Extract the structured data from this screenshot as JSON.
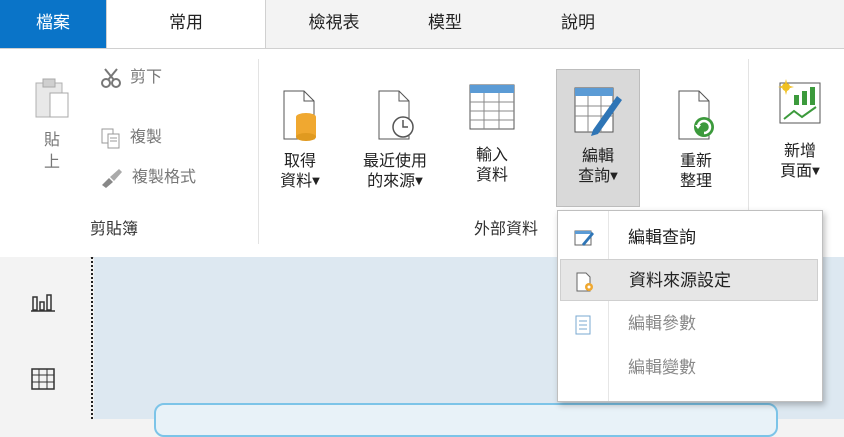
{
  "tabs": {
    "file": "檔案",
    "home": "常用",
    "view": "檢視表",
    "modeling": "模型",
    "help": "說明"
  },
  "clipboard": {
    "paste": "貼\n上",
    "paste_l1": "貼",
    "paste_l2": "上",
    "cut": "剪下",
    "copy": "複製",
    "format_painter": "複製格式",
    "group_label": "剪貼簿"
  },
  "external_data": {
    "get_data_l1": "取得",
    "get_data_l2": "資料",
    "recent_l1": "最近使用",
    "recent_l2": "的來源",
    "enter_l1": "輸入",
    "enter_l2": "資料",
    "edit_queries_l1": "編輯",
    "edit_queries_l2": "查詢",
    "refresh_l1": "重新",
    "refresh_l2": "整理",
    "group_label": "外部資料"
  },
  "insert": {
    "new_page_l1": "新增",
    "new_page_l2": "頁面"
  },
  "dropdown": {
    "items": [
      {
        "label": "編輯查詢",
        "enabled": true
      },
      {
        "label": "資料來源設定",
        "enabled": true,
        "highlighted": true
      },
      {
        "label": "編輯參數",
        "enabled": false
      },
      {
        "label": "編輯變數",
        "enabled": false
      }
    ]
  },
  "colors": {
    "file_tab": "#0a74c8",
    "canvas": "#dde8f1",
    "accent_orange": "#f0a830",
    "accent_green": "#3c9a3c"
  }
}
